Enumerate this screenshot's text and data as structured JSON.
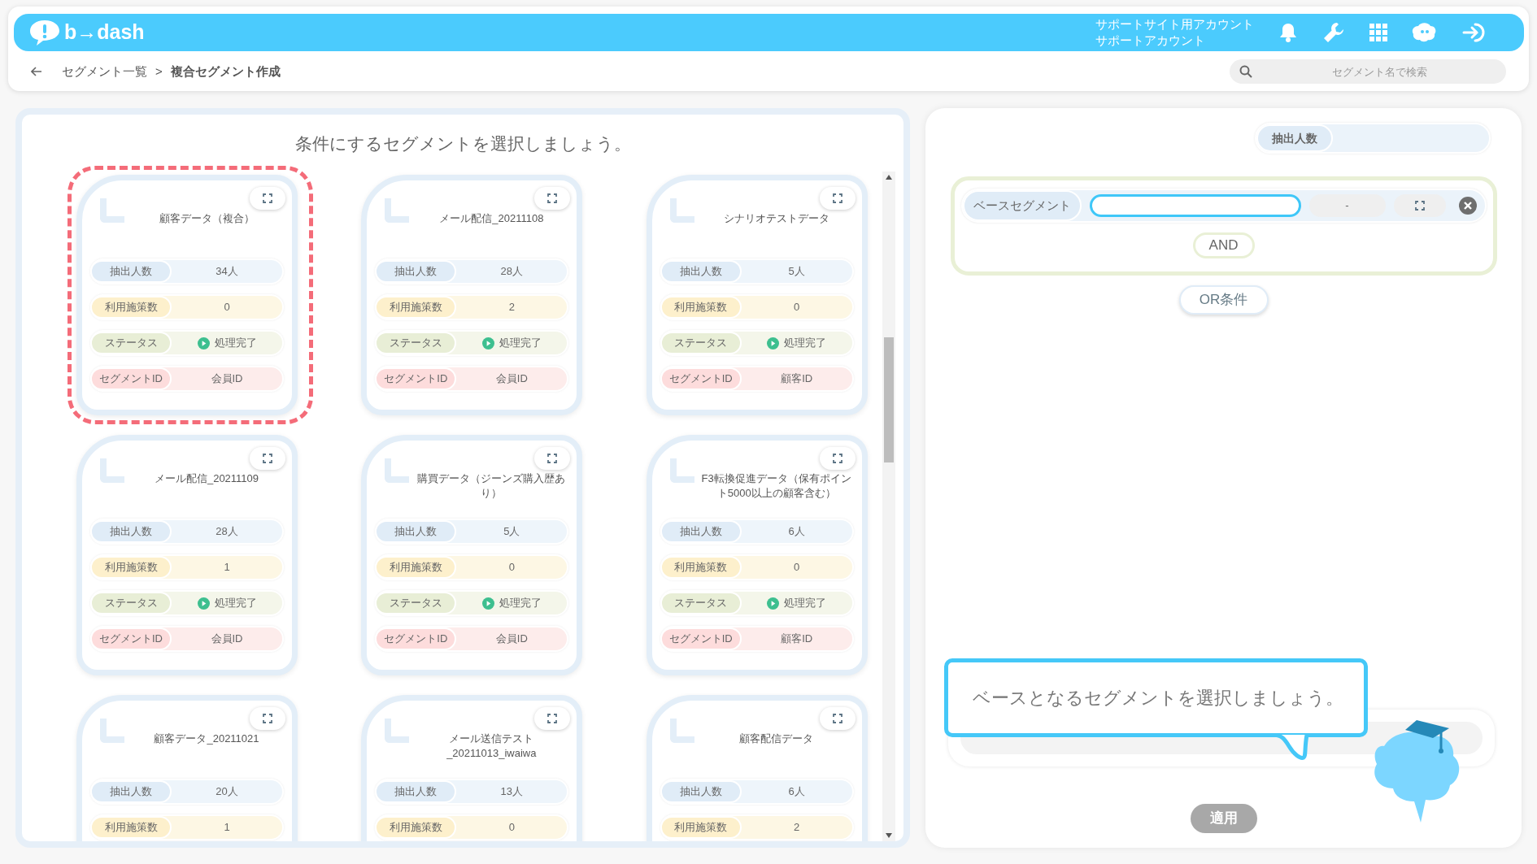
{
  "header": {
    "logo": "b→dash",
    "account_line_1": "サポートサイト用アカウント",
    "account_line_2": "サポートアカウント"
  },
  "breadcrumb": {
    "items": [
      "セグメント一覧",
      "複合セグメント作成"
    ],
    "separator": ">"
  },
  "search": {
    "placeholder": "セグメント名で検索"
  },
  "left_panel": {
    "title": "条件にするセグメントを選択しましょう。",
    "cards": [
      {
        "title": "顧客データ（複合）",
        "selected": true,
        "rows": [
          {
            "kind": "count",
            "label": "抽出人数",
            "value": "34人"
          },
          {
            "kind": "uses",
            "label": "利用施策数",
            "value": "0"
          },
          {
            "kind": "status",
            "label": "ステータス",
            "value": "処理完了"
          },
          {
            "kind": "id",
            "label": "セグメントID",
            "value": "会員ID"
          }
        ]
      },
      {
        "title": "メール配信_20211108",
        "selected": false,
        "rows": [
          {
            "kind": "count",
            "label": "抽出人数",
            "value": "28人"
          },
          {
            "kind": "uses",
            "label": "利用施策数",
            "value": "2"
          },
          {
            "kind": "status",
            "label": "ステータス",
            "value": "処理完了"
          },
          {
            "kind": "id",
            "label": "セグメントID",
            "value": "会員ID"
          }
        ]
      },
      {
        "title": "シナリオテストデータ",
        "selected": false,
        "rows": [
          {
            "kind": "count",
            "label": "抽出人数",
            "value": "5人"
          },
          {
            "kind": "uses",
            "label": "利用施策数",
            "value": "0"
          },
          {
            "kind": "status",
            "label": "ステータス",
            "value": "処理完了"
          },
          {
            "kind": "id",
            "label": "セグメントID",
            "value": "顧客ID"
          }
        ]
      },
      {
        "title": "メール配信_20211109",
        "selected": false,
        "rows": [
          {
            "kind": "count",
            "label": "抽出人数",
            "value": "28人"
          },
          {
            "kind": "uses",
            "label": "利用施策数",
            "value": "1"
          },
          {
            "kind": "status",
            "label": "ステータス",
            "value": "処理完了"
          },
          {
            "kind": "id",
            "label": "セグメントID",
            "value": "会員ID"
          }
        ]
      },
      {
        "title": "購買データ（ジーンズ購入歴あり）",
        "selected": false,
        "rows": [
          {
            "kind": "count",
            "label": "抽出人数",
            "value": "5人"
          },
          {
            "kind": "uses",
            "label": "利用施策数",
            "value": "0"
          },
          {
            "kind": "status",
            "label": "ステータス",
            "value": "処理完了"
          },
          {
            "kind": "id",
            "label": "セグメントID",
            "value": "会員ID"
          }
        ]
      },
      {
        "title": "F3転換促進データ（保有ポイント5000以上の顧客含む）",
        "selected": false,
        "rows": [
          {
            "kind": "count",
            "label": "抽出人数",
            "value": "6人"
          },
          {
            "kind": "uses",
            "label": "利用施策数",
            "value": "0"
          },
          {
            "kind": "status",
            "label": "ステータス",
            "value": "処理完了"
          },
          {
            "kind": "id",
            "label": "セグメントID",
            "value": "顧客ID"
          }
        ]
      },
      {
        "title": "顧客データ_20211021",
        "selected": false,
        "rows": [
          {
            "kind": "count",
            "label": "抽出人数",
            "value": "20人"
          },
          {
            "kind": "uses",
            "label": "利用施策数",
            "value": "1"
          }
        ]
      },
      {
        "title": "メール送信テスト_20211013_iwaiwa",
        "selected": false,
        "rows": [
          {
            "kind": "count",
            "label": "抽出人数",
            "value": "13人"
          },
          {
            "kind": "uses",
            "label": "利用施策数",
            "value": "0"
          }
        ]
      },
      {
        "title": "顧客配信データ",
        "selected": false,
        "rows": [
          {
            "kind": "count",
            "label": "抽出人数",
            "value": "6人"
          },
          {
            "kind": "uses",
            "label": "利用施策数",
            "value": "2"
          }
        ]
      }
    ]
  },
  "right_panel": {
    "count_label": "抽出人数",
    "condition": {
      "label": "ベースセグメント",
      "count": "-",
      "and_button": "AND"
    },
    "or_button": "OR条件",
    "apply_button": {
      "label": "適用",
      "disabled": true
    },
    "hint": "ベースとなるセグメントを選択しましょう。"
  }
}
